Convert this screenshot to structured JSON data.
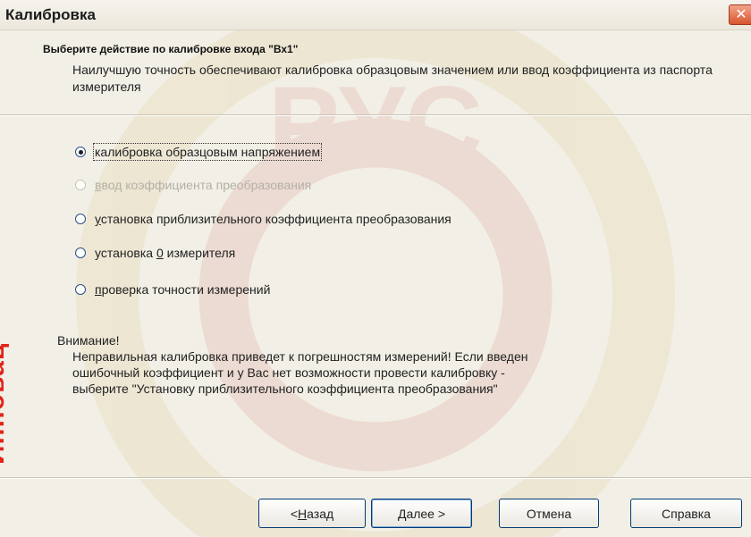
{
  "window": {
    "title": "Калибровка",
    "close_glyph": "✕"
  },
  "header": {
    "title": "Выберите действие по калибровке входа \"Вх1\"",
    "description": "Наилучшую точность обеспечивают калибровка образцовым значением или ввод коэффициента из паспорта измерителя"
  },
  "options": [
    {
      "label": "калибровка образцовым напряжением",
      "checked": true,
      "enabled": true
    },
    {
      "pre": "",
      "mn": "в",
      "post": "вод коэффициента преобразования",
      "checked": false,
      "enabled": false
    },
    {
      "pre": "",
      "mn": "у",
      "post": "становка приблизительного коэффициента преобразования",
      "checked": false,
      "enabled": true
    },
    {
      "pre": "установка ",
      "mn": "0",
      "post": " измерителя",
      "checked": false,
      "enabled": true
    },
    {
      "pre": "",
      "mn": "п",
      "post": "роверка точности измерений",
      "checked": false,
      "enabled": true
    }
  ],
  "warning": {
    "title": "Внимание!",
    "text_lines": [
      "Неправильная калибровка приведет к погрешностям измерений! Если введен",
      "ошибочный коэффициент и у Вас нет возможности провести калибровку -",
      "выберите \"Установку приблизительного коэффициента преобразования\""
    ]
  },
  "buttons": {
    "back": {
      "pre": "< ",
      "mn": "Н",
      "post": "азад"
    },
    "next": {
      "pre": "",
      "mn": "Д",
      "post": "алее >"
    },
    "cancel": "Отмена",
    "help": "Справка"
  },
  "side_text": "Инновац"
}
